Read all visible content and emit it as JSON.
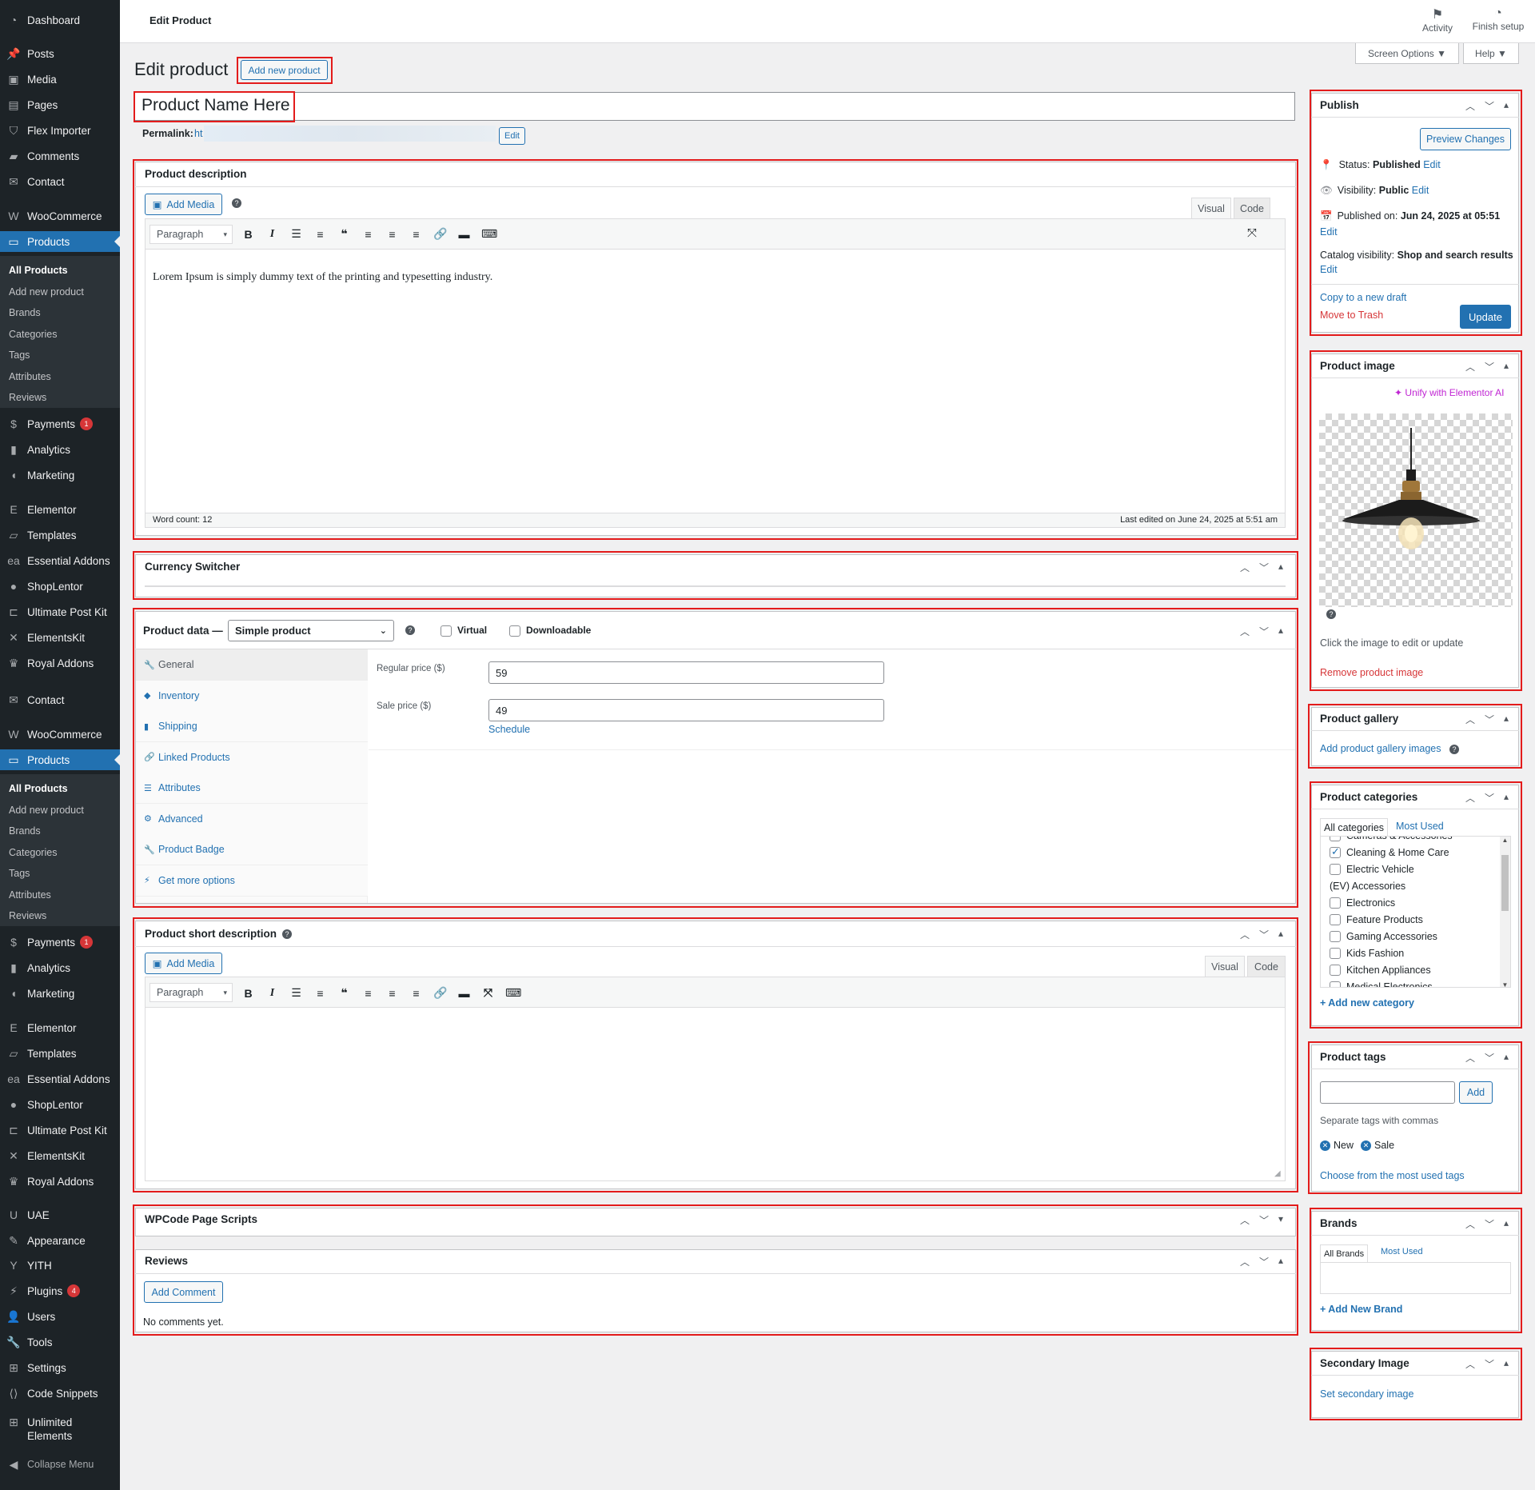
{
  "sidebar": {
    "top_items": [
      {
        "label": "Dashboard",
        "icon": "dashboard-icon"
      },
      {
        "label": "Posts",
        "icon": "pin-icon"
      },
      {
        "label": "Media",
        "icon": "media-icon"
      },
      {
        "label": "Pages",
        "icon": "pages-icon"
      },
      {
        "label": "Flex Importer",
        "icon": "filter-icon"
      },
      {
        "label": "Comments",
        "icon": "comment-icon"
      },
      {
        "label": "Contact",
        "icon": "mail-icon"
      },
      {
        "label": "WooCommerce",
        "icon": "woo-icon"
      },
      {
        "label": "Products",
        "icon": "archive-icon"
      }
    ],
    "products_sub": [
      "All Products",
      "Add new product",
      "Brands",
      "Categories",
      "Tags",
      "Attributes",
      "Reviews"
    ],
    "mid_items": [
      {
        "label": "Payments",
        "icon": "payments-icon",
        "badge": "1"
      },
      {
        "label": "Analytics",
        "icon": "chart-icon"
      },
      {
        "label": "Marketing",
        "icon": "megaphone-icon"
      },
      {
        "label": "Elementor",
        "icon": "elementor-icon"
      },
      {
        "label": "Templates",
        "icon": "folder-icon"
      },
      {
        "label": "Essential Addons",
        "icon": "ea-icon"
      },
      {
        "label": "ShopLentor",
        "icon": "shoplentor-icon"
      },
      {
        "label": "Ultimate Post Kit",
        "icon": "upk-icon"
      },
      {
        "label": "ElementsKit",
        "icon": "ek-icon"
      },
      {
        "label": "Royal Addons",
        "icon": "crown-icon"
      },
      {
        "label": "Contact",
        "icon": "mail-icon"
      },
      {
        "label": "WooCommerce",
        "icon": "woo-icon"
      },
      {
        "label": "Products",
        "icon": "archive-icon"
      }
    ],
    "products_sub2": [
      "All Products",
      "Add new product",
      "Brands",
      "Categories",
      "Tags",
      "Attributes",
      "Reviews"
    ],
    "bottom_items": [
      {
        "label": "Payments",
        "icon": "payments-icon",
        "badge": "1"
      },
      {
        "label": "Analytics",
        "icon": "chart-icon"
      },
      {
        "label": "Marketing",
        "icon": "megaphone-icon"
      },
      {
        "label": "Elementor",
        "icon": "elementor-icon"
      },
      {
        "label": "Templates",
        "icon": "folder-icon"
      },
      {
        "label": "Essential Addons",
        "icon": "ea-icon"
      },
      {
        "label": "ShopLentor",
        "icon": "shoplentor-icon"
      },
      {
        "label": "Ultimate Post Kit",
        "icon": "upk-icon"
      },
      {
        "label": "ElementsKit",
        "icon": "ek-icon"
      },
      {
        "label": "Royal Addons",
        "icon": "crown-icon"
      },
      {
        "label": "UAE",
        "icon": "uae-icon"
      },
      {
        "label": "Appearance",
        "icon": "brush-icon"
      },
      {
        "label": "YITH",
        "icon": "yith-icon"
      },
      {
        "label": "Plugins",
        "icon": "plugin-icon",
        "badge": "4"
      },
      {
        "label": "Users",
        "icon": "user-icon"
      },
      {
        "label": "Tools",
        "icon": "wrench-icon"
      },
      {
        "label": "Settings",
        "icon": "settings-icon"
      },
      {
        "label": "Code Snippets",
        "icon": "code-icon"
      }
    ],
    "unlimited": "Unlimited",
    "elements": "Elements",
    "collapse": "Collapse Menu"
  },
  "topbar": {
    "title": "Edit Product",
    "activity": "Activity",
    "finish": "Finish setup"
  },
  "screen_options": "Screen Options ▼",
  "help": "Help ▼",
  "page": {
    "heading": "Edit product",
    "add_new": "Add new product",
    "product_name": "Product Name Here",
    "permalink_label": "Permalink:",
    "permalink_link": "ht",
    "permalink_edit": "Edit"
  },
  "description": {
    "title": "Product description",
    "add_media": "Add Media",
    "tab_visual": "Visual",
    "tab_code": "Code",
    "format": "Paragraph",
    "content": "Lorem Ipsum is simply dummy text of the printing and typesetting industry.",
    "word_count": "Word count: 12",
    "last_edited": "Last edited on June 24, 2025 at 5:51 am"
  },
  "currency": {
    "title": "Currency Switcher"
  },
  "product_data": {
    "title": "Product data —",
    "type": "Simple product",
    "virtual": "Virtual",
    "downloadable": "Downloadable",
    "tabs": [
      {
        "label": "General",
        "icon": "wrench-icon"
      },
      {
        "label": "Inventory",
        "icon": "tag-icon"
      },
      {
        "label": "Shipping",
        "icon": "truck-icon"
      },
      {
        "label": "Linked Products",
        "icon": "link-icon"
      },
      {
        "label": "Attributes",
        "icon": "list-icon"
      },
      {
        "label": "Advanced",
        "icon": "gear-icon"
      },
      {
        "label": "Product Badge",
        "icon": "wrench-icon"
      },
      {
        "label": "Get more options",
        "icon": "plugin-icon"
      }
    ],
    "regular_label": "Regular price ($)",
    "regular_value": "59",
    "sale_label": "Sale price ($)",
    "sale_value": "49",
    "schedule": "Schedule"
  },
  "short_desc": {
    "title": "Product short description",
    "add_media": "Add Media",
    "tab_visual": "Visual",
    "tab_code": "Code",
    "format": "Paragraph"
  },
  "wpcode": {
    "title": "WPCode Page Scripts"
  },
  "reviews": {
    "title": "Reviews",
    "add_comment": "Add Comment",
    "none": "No comments yet."
  },
  "publish": {
    "title": "Publish",
    "preview": "Preview Changes",
    "status_label": "Status:",
    "status_value": "Published",
    "visibility_label": "Visibility:",
    "visibility_value": "Public",
    "published_label": "Published on:",
    "published_value": "Jun 24, 2025 at 05:51",
    "catalog_label": "Catalog visibility:",
    "catalog_value": "Shop and search results",
    "edit": "Edit",
    "copy": "Copy to a new draft",
    "trash": "Move to Trash",
    "update": "Update"
  },
  "product_image": {
    "title": "Product image",
    "unify": "Unify with Elementor AI",
    "hint": "Click the image to edit or update",
    "remove": "Remove product image"
  },
  "gallery": {
    "title": "Product gallery",
    "add": "Add product gallery images"
  },
  "categories": {
    "title": "Product categories",
    "tab_all": "All categories",
    "tab_most": "Most Used",
    "items": [
      {
        "label": "Cameras & Accessories",
        "checked": false,
        "cb": true
      },
      {
        "label": "Cleaning & Home Care",
        "checked": true,
        "cb": true
      },
      {
        "label": "Electric Vehicle",
        "checked": false,
        "cb": true
      },
      {
        "label": "(EV) Accessories",
        "checked": false,
        "cb": false
      },
      {
        "label": "Electronics",
        "checked": false,
        "cb": true
      },
      {
        "label": "Feature Products",
        "checked": false,
        "cb": true
      },
      {
        "label": "Gaming Accessories",
        "checked": false,
        "cb": true
      },
      {
        "label": "Kids Fashion",
        "checked": false,
        "cb": true
      },
      {
        "label": "Kitchen Appliances",
        "checked": false,
        "cb": true
      },
      {
        "label": "Medical Electronics",
        "checked": false,
        "cb": true
      }
    ],
    "add_new": "+ Add new category"
  },
  "tags": {
    "title": "Product tags",
    "add": "Add",
    "hint": "Separate tags with commas",
    "items": [
      "New",
      "Sale"
    ],
    "choose": "Choose from the most used tags"
  },
  "brands": {
    "title": "Brands",
    "tab_all": "All Brands",
    "tab_most": "Most Used",
    "add_new": "+ Add New Brand"
  },
  "secondary": {
    "title": "Secondary Image",
    "set": "Set secondary image"
  },
  "colors": {
    "accent": "#2271b1",
    "sidebar": "#1d2327",
    "highlight": "#e31b1b",
    "danger": "#d63638"
  }
}
